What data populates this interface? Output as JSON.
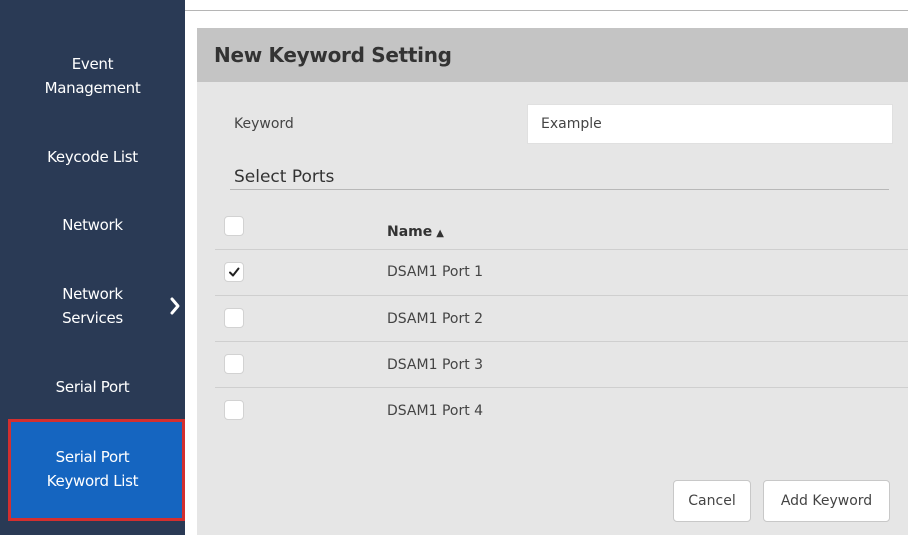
{
  "sidebar": {
    "items": [
      {
        "label": "Event\nManagement",
        "active": false,
        "has_chevron": false
      },
      {
        "label": "Keycode List",
        "active": false,
        "has_chevron": false
      },
      {
        "label": "Network",
        "active": false,
        "has_chevron": false
      },
      {
        "label": "Network\nServices",
        "active": false,
        "has_chevron": true,
        "chevron_icon": "chevron-right-icon"
      },
      {
        "label": "Serial Port",
        "active": false,
        "has_chevron": false
      },
      {
        "label": "Serial Port\nKeyword List",
        "active": true,
        "has_chevron": false
      }
    ],
    "active_color": "#1565c0",
    "highlight_border_color": "#d32f2f"
  },
  "panel": {
    "title": "New Keyword Setting",
    "keyword": {
      "label": "Keyword",
      "value": "Example"
    },
    "ports_section": {
      "title": "Select Ports",
      "header": {
        "name_label": "Name",
        "sort_indicator": "▲",
        "select_all_checked": false
      },
      "ports": [
        {
          "name": "DSAM1 Port 1",
          "checked": true
        },
        {
          "name": "DSAM1 Port 2",
          "checked": false
        },
        {
          "name": "DSAM1 Port 3",
          "checked": false
        },
        {
          "name": "DSAM1 Port 4",
          "checked": false
        }
      ]
    },
    "actions": {
      "cancel_label": "Cancel",
      "add_label": "Add Keyword"
    }
  }
}
